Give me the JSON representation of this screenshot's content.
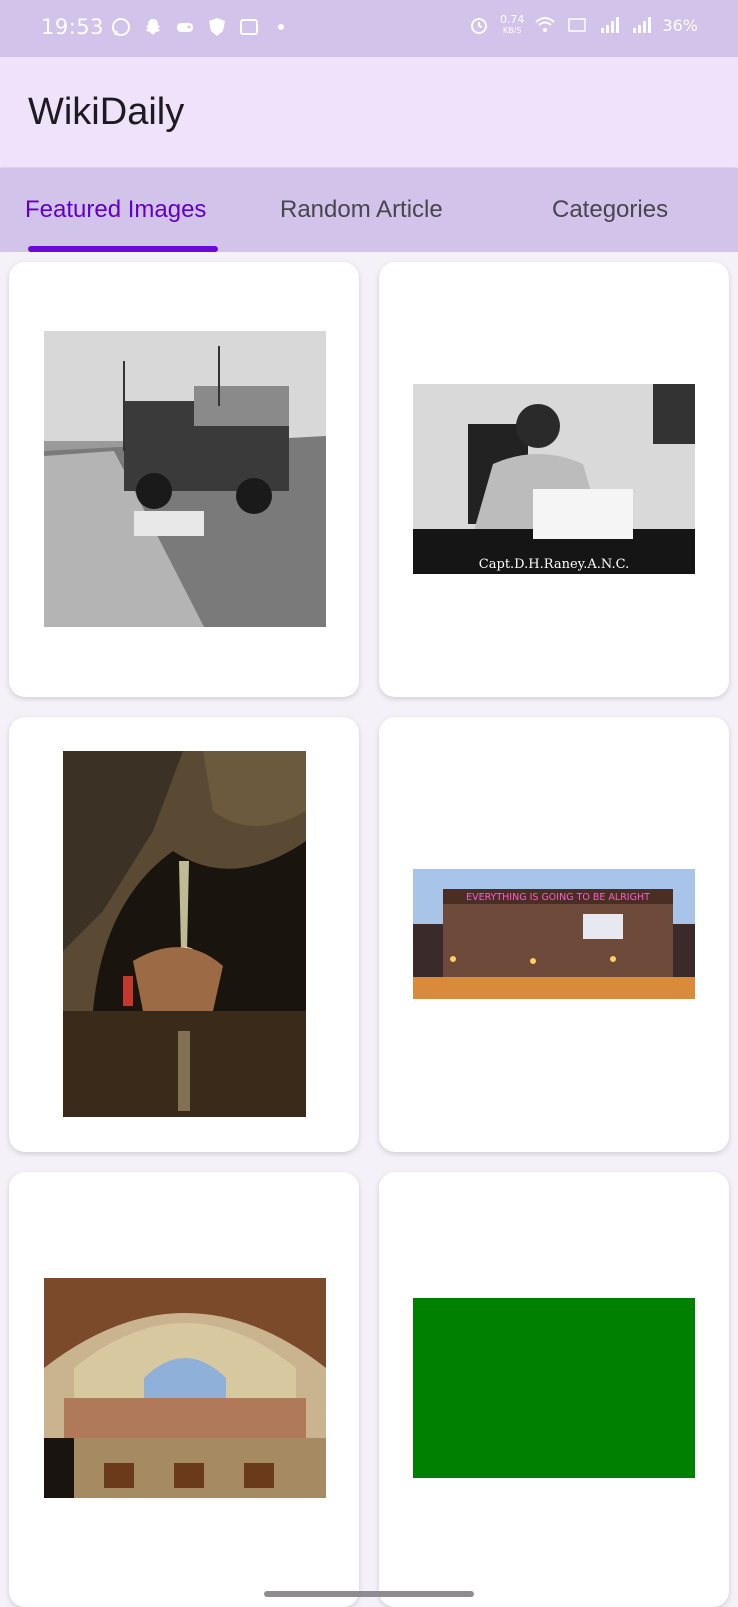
{
  "status_bar": {
    "time": "19:53",
    "speed": "0.74",
    "speed_unit": "KB/S",
    "battery": "36%"
  },
  "app": {
    "title": "WikiDaily"
  },
  "tabs": [
    {
      "label": "Featured Images",
      "active": true
    },
    {
      "label": "Random Article",
      "active": false
    },
    {
      "label": "Categories",
      "active": false
    }
  ],
  "images": [
    {
      "name": "dust-bowl-car-photo"
    },
    {
      "name": "captain-raney-portrait-photo",
      "caption": "Capt.D.H.Raney.A.N.C."
    },
    {
      "name": "cave-light-beam-photo"
    },
    {
      "name": "building-neon-sign-photo",
      "sign": "EVERYTHING IS GOING TO BE ALRIGHT"
    },
    {
      "name": "school-of-athens-painting"
    },
    {
      "name": "green-rectangle-image"
    }
  ],
  "colors": {
    "status_bar": "#d2c3ea",
    "app_bar": "#efe2fb",
    "tab_active": "#6200c9",
    "indicator": "#6a0ad8",
    "green_image": "#008000"
  }
}
